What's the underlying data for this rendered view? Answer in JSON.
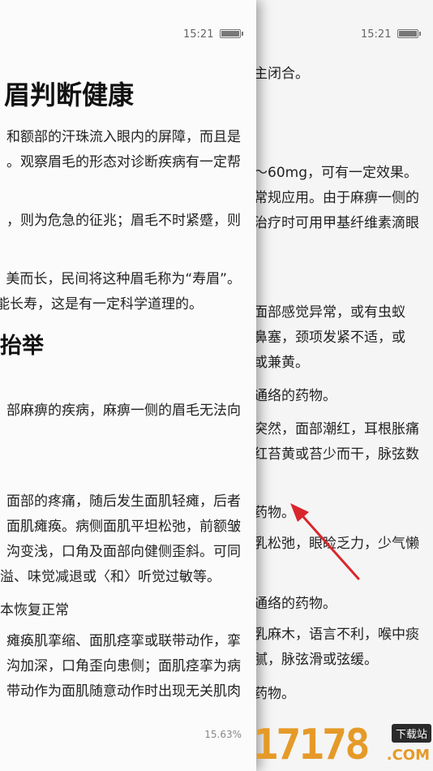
{
  "status": {
    "time": "15:21"
  },
  "front": {
    "title": "眉判断健康",
    "subtitle": "抬举",
    "progress": "15.63%",
    "lines": [
      "和额部的汗珠流入眼内的屏障，而且是",
      "。观察眉毛的形态对诊断疾病有一定帮",
      "，则为危急的征兆；眉毛不时紧蹙，则",
      "美而长，民间将这种眉毛称为“寿眉”。",
      "能长寿，这是有一定科学道理的。",
      "部麻痹的疾病，麻痹一侧的眉毛无法向",
      "面部的疼痛，随后发生面肌轻瘫，后者",
      "面肌瘫痪。病侧面肌平坦松弛，前额皱",
      "沟变浅，口角及面部向健侧歪斜。可同",
      "溢、味觉减退或〈和〉听觉过敏等。",
      "本恢复正常",
      "瘫痪肌挛缩、面肌痉挛或联带动作，挛",
      "沟加深，口角歪向患侧；面肌痉挛为病",
      "带动作为面肌随意动作时出现无关肌肉"
    ]
  },
  "back": {
    "lines": [
      "主闭合。",
      "～60mg，可有一定效果。",
      "常规应用。由于麻痹一侧的",
      "治疗时可用甲基纤维素滴眼",
      "面部感觉异常，或有虫蚁",
      "鼻塞，颈项发紧不适，或",
      "或兼黄。",
      "通络的药物。",
      "突然，面部潮红，耳根胀痛",
      "红苔黄或苔少而干，脉弦数",
      "药物。",
      "乳松弛，眼睑乏力，少气懒",
      "通络的药物。",
      "乳麻木，语言不利，喉中痰",
      "腻，脉弦滑或弦缓。",
      "药物。"
    ]
  },
  "watermark": {
    "number": "17178",
    "badge": "下载站",
    "domain": ".COM"
  },
  "colors": {
    "arrow": "#d9262c",
    "logo": "#e59a28"
  }
}
